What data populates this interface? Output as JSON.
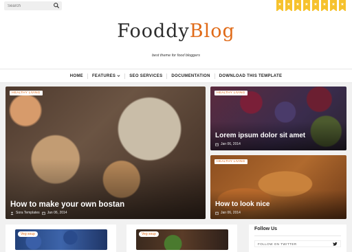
{
  "search": {
    "placeholder": "Search"
  },
  "flags": [
    "★",
    "★",
    "★",
    "★",
    "★",
    "★",
    "★",
    "★"
  ],
  "logo": {
    "part1": "Fooddy",
    "part2": "Blog"
  },
  "tagline": "best theme for food bloggers",
  "nav": {
    "items": [
      "HOME",
      "FEATURES",
      "SEO SERVICES",
      "DOCUMENTATION",
      "DOWNLOAD THIS TEMPLATE"
    ]
  },
  "featured": [
    {
      "tag": "HEALTHY LIVING",
      "title": "How to make your own bostan",
      "author": "Sora Templates",
      "date": "Jan 06, 2014"
    },
    {
      "tag": "HEALTHY LIVING",
      "title": "Lorem ipsum dolor sit amet",
      "date": "Jan 06, 2014"
    },
    {
      "tag": "HEALTHY LIVING",
      "title": "How to look nice",
      "date": "Jan 06, 2014"
    }
  ],
  "posts": [
    {
      "tag": "Veg soup"
    },
    {
      "tag": "Veg soup"
    }
  ],
  "sidebar": {
    "title": "Follow Us",
    "twitter": "FOLLOW ON TWITTER"
  },
  "colors": {
    "accent": "#e06a17",
    "flag": "#f6c22d"
  }
}
